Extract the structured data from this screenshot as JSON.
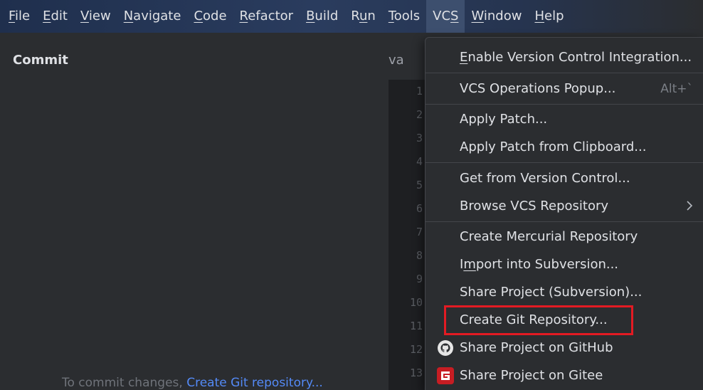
{
  "menubar": {
    "items": [
      {
        "pre": "",
        "mn": "F",
        "post": "ile"
      },
      {
        "pre": "",
        "mn": "E",
        "post": "dit"
      },
      {
        "pre": "",
        "mn": "V",
        "post": "iew"
      },
      {
        "pre": "",
        "mn": "N",
        "post": "avigate"
      },
      {
        "pre": "",
        "mn": "C",
        "post": "ode"
      },
      {
        "pre": "",
        "mn": "R",
        "post": "efactor"
      },
      {
        "pre": "",
        "mn": "B",
        "post": "uild"
      },
      {
        "pre": "R",
        "mn": "u",
        "post": "n"
      },
      {
        "pre": "",
        "mn": "T",
        "post": "ools"
      },
      {
        "pre": "VC",
        "mn": "S",
        "post": ""
      },
      {
        "pre": "",
        "mn": "W",
        "post": "indow"
      },
      {
        "pre": "",
        "mn": "H",
        "post": "elp"
      }
    ]
  },
  "commit_panel": {
    "title": "Commit",
    "hint_text": "To commit changes, ",
    "hint_link": "Create Git repository..."
  },
  "editor": {
    "tab_fragment": "va",
    "line_numbers": [
      "1",
      "2",
      "3",
      "4",
      "5",
      "6",
      "7",
      "8",
      "9",
      "10",
      "11",
      "12",
      "13"
    ]
  },
  "vcs_menu": {
    "enable_vci": {
      "pre": "",
      "mn": "E",
      "post": "nable Version Control Integration..."
    },
    "ops_popup": {
      "label": "VCS Operations Popup...",
      "shortcut": "Alt+`"
    },
    "apply_patch": "Apply Patch...",
    "apply_patch_clipboard": "Apply Patch from Clipboard...",
    "get_from_vc": "Get from Version Control...",
    "browse_repo": "Browse VCS Repository",
    "create_mercurial": "Create Mercurial Repository",
    "import_svn": {
      "pre": "I",
      "mn": "m",
      "post": "port into Subversion..."
    },
    "share_svn": "Share Project (Subversion)...",
    "create_git": "Create Git Repository...",
    "share_github": "Share Project on GitHub",
    "share_gitee": "Share Project on Gitee"
  },
  "colors": {
    "highlight": "#e31b23",
    "gitee": "#c71d23",
    "link": "#548af7"
  }
}
